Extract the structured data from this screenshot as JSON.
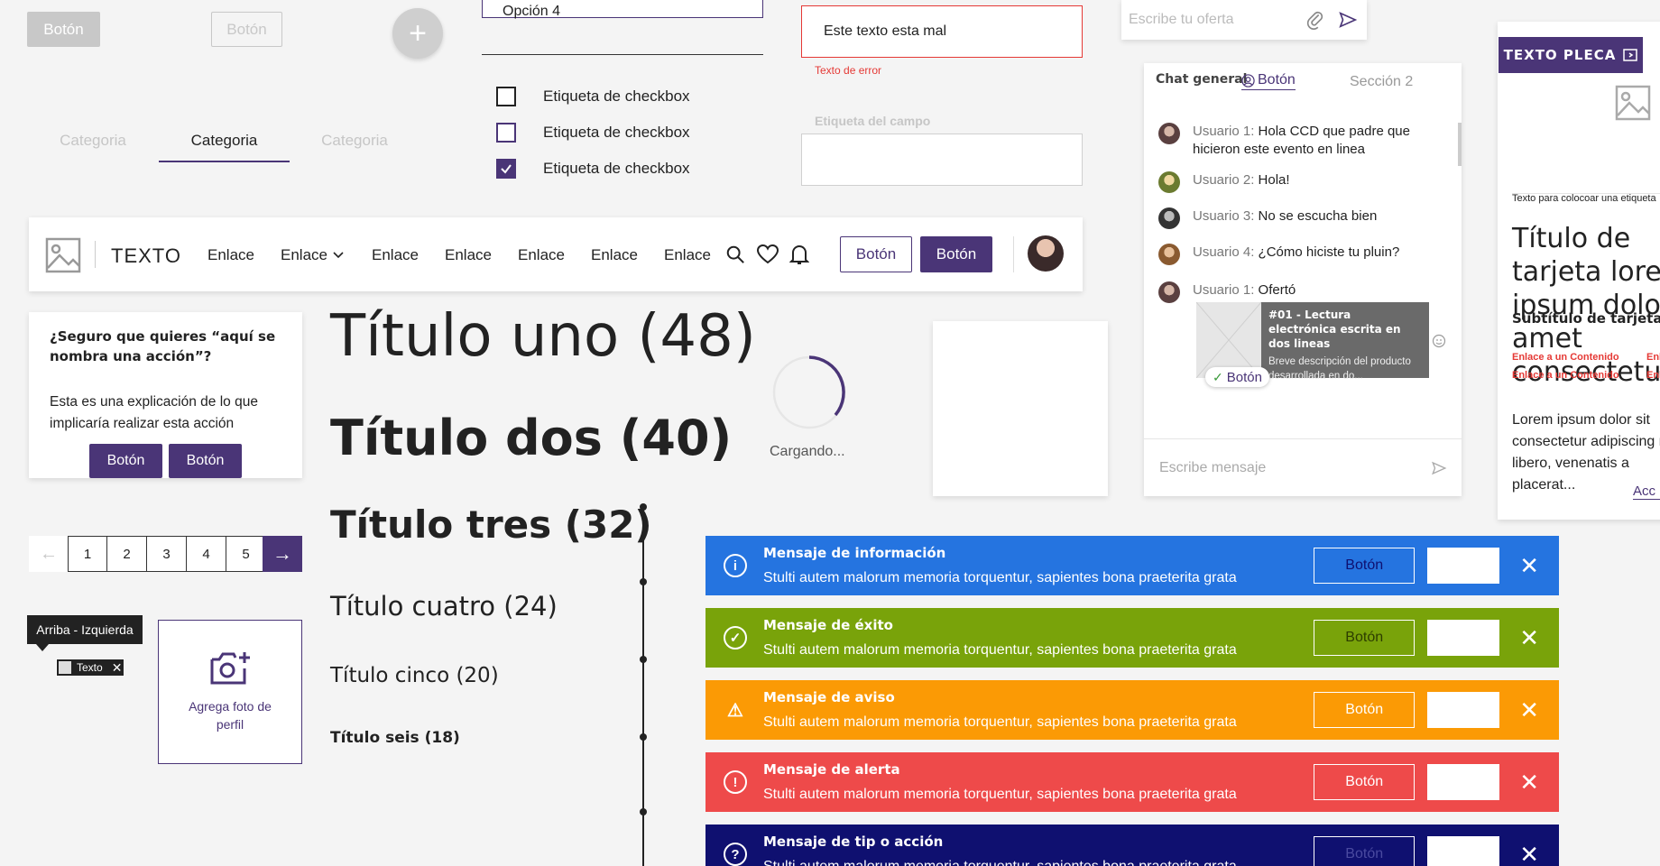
{
  "buttons": {
    "disabled": "Botón",
    "ghost_disabled": "Botón",
    "fab": "+"
  },
  "select": {
    "option": "Opción 4"
  },
  "tabs": [
    {
      "label": "Categoria"
    },
    {
      "label": "Categoria"
    },
    {
      "label": "Categoria"
    }
  ],
  "checkboxes": [
    {
      "label": "Etiqueta de checkbox",
      "checked": false
    },
    {
      "label": "Etiqueta de checkbox",
      "checked": false
    },
    {
      "label": "Etiqueta de checkbox",
      "checked": true
    }
  ],
  "error_field": {
    "value": "Este texto esta mal",
    "error": "Texto de error"
  },
  "field": {
    "label": "Etiqueta del campo"
  },
  "offer": {
    "placeholder": "Escribe tu oferta"
  },
  "navbar": {
    "brand": "TEXTO",
    "links": [
      "Enlace",
      "Enlace",
      "Enlace",
      "Enlace",
      "Enlace",
      "Enlace",
      "Enlace"
    ],
    "outline_button": "Botón",
    "primary_button": "Botón"
  },
  "dialog": {
    "title": "¿Seguro que  quieres “aquí se nombra una acción”?",
    "body": "Esta es una explicación de lo que implicaría realizar esta acción",
    "button1": "Botón",
    "button2": "Botón"
  },
  "titles": {
    "t1": "Título uno (48)",
    "t2": "Título dos (40)",
    "t3": "Título tres (32)",
    "t4": "Título cuatro (24)",
    "t5": "Título cinco (20)",
    "t6": "Título seis (18)"
  },
  "loader": {
    "label": "Cargando..."
  },
  "pagination": {
    "pages": [
      "1",
      "2",
      "3",
      "4",
      "5"
    ],
    "prev": "←",
    "next": "→"
  },
  "tooltip": {
    "text": "Arriba - Izquierda"
  },
  "chip": {
    "label": "Texto"
  },
  "photo_upload": {
    "label": "Agrega foto de perfil"
  },
  "chat": {
    "tab1": "Chat general",
    "tab2": "Botón",
    "tab3": "Sección 2",
    "messages": [
      {
        "user": "Usuario 1:",
        "text": "Hola CCD que padre que hicieron este evento en linea"
      },
      {
        "user": "Usuario 2:",
        "text": "Hola!"
      },
      {
        "user": "Usuario 3:",
        "text": "No se escucha bien"
      },
      {
        "user": "Usuario 4:",
        "text": "¿Cómo hiciste tu pluin?"
      },
      {
        "user": "Usuario 1:",
        "text": "Ofertó"
      }
    ],
    "product": {
      "title": "#01 - Lectura electrónica escrita en dos lineas",
      "desc": "Breve descripción del producto desarrollada en do..."
    },
    "accept_button": "Botón",
    "input_placeholder": "Escribe mensaje"
  },
  "side_card": {
    "pleca": "TEXTO PLECA",
    "tag": "Texto para colocoar una etiqueta",
    "title": "Título de tarjeta lorem ipsum dolor sit amet consectetur",
    "subtitle": "Subtítulo de tarjeta lorem",
    "links": [
      "Enlace a un Contenido",
      "Enlace",
      "Enlace a un Contenido",
      "Enlace"
    ],
    "body": "Lorem ipsum dolor sit consectetur adipiscing nisi libero, venenatis a placerat...",
    "action": "Acc"
  },
  "messages": [
    {
      "title": "Mensaje de información",
      "text": "Stulti autem malorum memoria torquentur, sapientes bona praeterita grata",
      "button": "Botón",
      "color": "#2574e0",
      "icon": "i"
    },
    {
      "title": "Mensaje de éxito",
      "text": "Stulti autem malorum memoria torquentur, sapientes bona praeterita grata",
      "button": "Botón",
      "color": "#79a30a",
      "icon": "✓"
    },
    {
      "title": "Mensaje de aviso",
      "text": "Stulti autem malorum memoria torquentur, sapientes bona praeterita grata",
      "button": "Botón",
      "color": "#fb9a05",
      "icon": "!"
    },
    {
      "title": "Mensaje de alerta",
      "text": "Stulti autem malorum memoria torquentur, sapientes bona praeterita grata",
      "button": "Botón",
      "color": "#ee4a4a",
      "icon": "!"
    },
    {
      "title": "Mensaje de tip o acción",
      "text": "Stulti autem malorum memoria torquentur, sapientes bona praeterita grata",
      "button": "Botón",
      "color": "#0f1070",
      "icon": "?"
    }
  ],
  "colors": {
    "accent": "#4a3577",
    "error": "#e53935"
  }
}
